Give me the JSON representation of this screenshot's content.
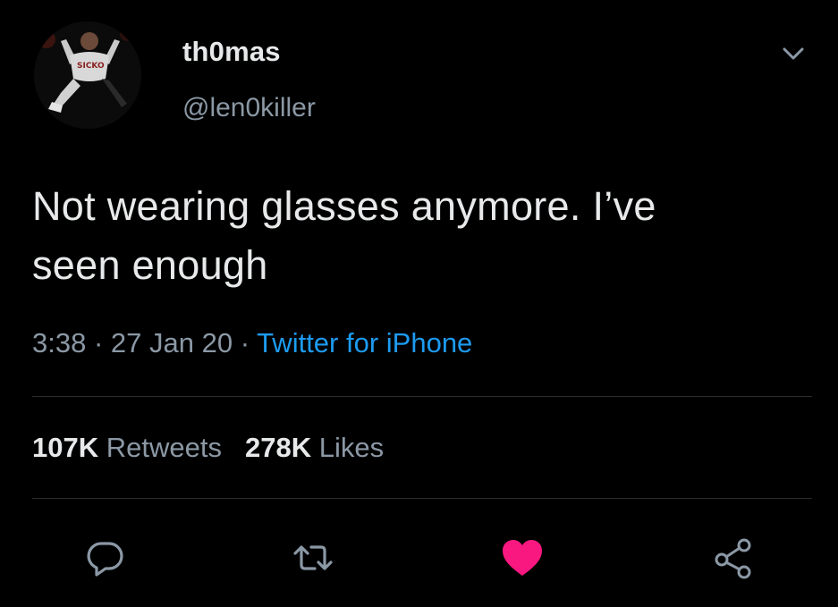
{
  "user": {
    "display_name": "th0mas",
    "handle": "@len0killer"
  },
  "tweet": {
    "text_line1": "Not wearing glasses anymore. I’ve",
    "text_line2": "seen enough"
  },
  "meta": {
    "time": "3:38",
    "sep1": " · ",
    "date": "27 Jan 20",
    "sep2": " · ",
    "source": "Twitter for iPhone"
  },
  "stats": {
    "retweets_count": "107K",
    "retweets_label": "Retweets",
    "likes_count": "278K",
    "likes_label": "Likes"
  },
  "actions": [
    {
      "name": "reply",
      "icon": "reply-icon"
    },
    {
      "name": "retweet",
      "icon": "retweet-icon"
    },
    {
      "name": "like",
      "icon": "heart-icon",
      "active": true
    },
    {
      "name": "share",
      "icon": "share-icon"
    }
  ],
  "colors": {
    "background": "#000000",
    "primary_text": "#e7e9ea",
    "secondary_text": "#8b98a5",
    "link": "#1d9bf0",
    "like_active": "#f91880",
    "divider": "#2a2d30"
  }
}
